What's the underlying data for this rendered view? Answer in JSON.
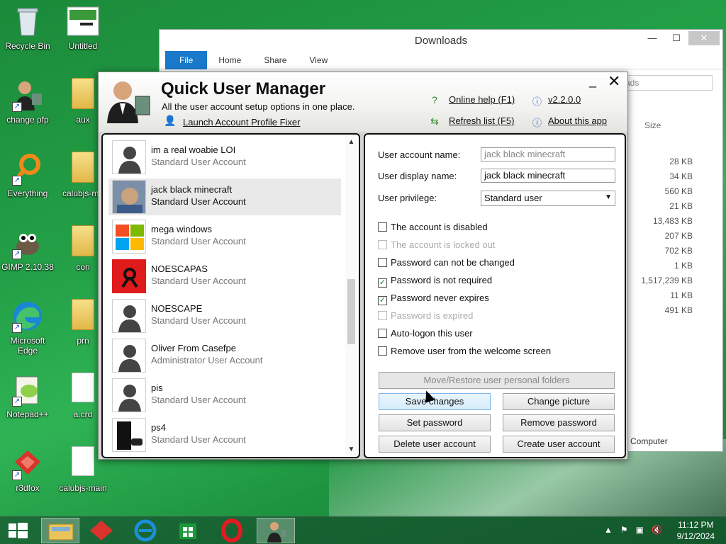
{
  "desktop": {
    "icons": [
      {
        "label": "Recycle Bin"
      },
      {
        "label": "Untitled"
      },
      {
        "label": "change pfp"
      },
      {
        "label": "aux"
      },
      {
        "label": "Everything"
      },
      {
        "label": "calubjs-ma"
      },
      {
        "label": "GIMP 2.10.38"
      },
      {
        "label": "con"
      },
      {
        "label": "Microsoft Edge"
      },
      {
        "label": "prn"
      },
      {
        "label": "Notepad++"
      },
      {
        "label": "a.crd"
      },
      {
        "label": "r3dfox"
      },
      {
        "label": "calubjs-main"
      }
    ]
  },
  "explorer": {
    "title": "Downloads",
    "tabs": [
      "File",
      "Home",
      "Share",
      "View"
    ],
    "search_placeholder": "ads",
    "size_header": "Size",
    "sizes": [
      "28 KB",
      "34 KB",
      "560 KB",
      "21 KB",
      "13,483 KB",
      "207 KB",
      "702 KB",
      "1 KB",
      "1,517,239 KB",
      "11 KB",
      "491 KB"
    ],
    "status": "Computer"
  },
  "qum": {
    "title": "Quick User Manager",
    "subtitle": "All the user account setup options in one place.",
    "launch_link": "Launch Account Profile Fixer",
    "online_help": "Online help (F1)",
    "refresh": "Refresh list (F5)",
    "version": "v2.2.0.0",
    "about": "About this app",
    "users": [
      {
        "name": "im a real woabie LOI",
        "type": "Standard User Account"
      },
      {
        "name": "jack black minecraft",
        "type": "Standard User Account"
      },
      {
        "name": "mega windows",
        "type": "Standard User Account"
      },
      {
        "name": "NOESCAPAS",
        "type": "Standard User Account"
      },
      {
        "name": "NOESCAPE",
        "type": "Standard User Account"
      },
      {
        "name": "Oliver From Casefpe",
        "type": "Administrator User Account"
      },
      {
        "name": "pis",
        "type": "Standard User Account"
      },
      {
        "name": "ps4",
        "type": "Standard User Account"
      }
    ],
    "form": {
      "account_name_label": "User account name:",
      "account_name_value": "jack black minecraft",
      "display_name_label": "User display name:",
      "display_name_value": "jack black minecraft",
      "privilege_label": "User privilege:",
      "privilege_value": "Standard user"
    },
    "checks": [
      {
        "label": "The account is disabled",
        "checked": false,
        "disabled": false
      },
      {
        "label": "The account is locked out",
        "checked": false,
        "disabled": true
      },
      {
        "label": "Password can not be changed",
        "checked": false,
        "disabled": false
      },
      {
        "label": "Password is not required",
        "checked": true,
        "disabled": false
      },
      {
        "label": "Password never expires",
        "checked": true,
        "disabled": false
      },
      {
        "label": "Password is expired",
        "checked": false,
        "disabled": true
      },
      {
        "label": "Auto-logon this user",
        "checked": false,
        "disabled": false
      },
      {
        "label": "Remove user from the welcome screen",
        "checked": false,
        "disabled": false
      }
    ],
    "buttons": {
      "move_restore": "Move/Restore user personal folders",
      "save": "Save changes",
      "change_picture": "Change picture",
      "set_password": "Set password",
      "remove_password": "Remove password",
      "delete_user": "Delete user account",
      "create_user": "Create user account"
    }
  },
  "tray": {
    "time": "11:12 PM",
    "date": "9/12/2024"
  }
}
